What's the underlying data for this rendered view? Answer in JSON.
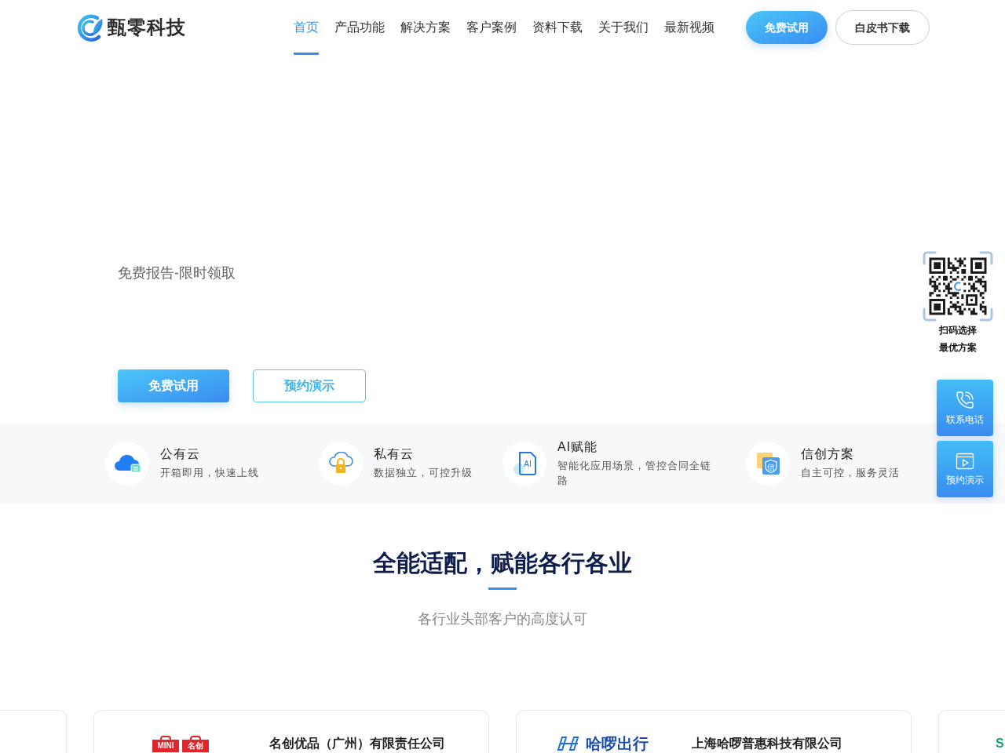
{
  "header": {
    "logo": {
      "text": "甄零科技"
    },
    "nav": [
      {
        "label": "首页",
        "selected": true
      },
      {
        "label": "产品功能",
        "selected": false
      },
      {
        "label": "解决方案",
        "selected": false
      },
      {
        "label": "客户案例",
        "selected": false
      },
      {
        "label": "资料下载",
        "selected": false
      },
      {
        "label": "关于我们",
        "selected": false
      },
      {
        "label": "最新视频",
        "selected": false
      }
    ],
    "buttons": [
      {
        "label": "免费试用",
        "kind": "primary"
      },
      {
        "label": "白皮书下载",
        "kind": "outline"
      }
    ]
  },
  "hero": {
    "tagline": "免费报告-限时领取",
    "buttons": [
      {
        "label": "免费试用",
        "kind": "primary"
      },
      {
        "label": "预约演示",
        "kind": "outline"
      }
    ]
  },
  "features": [
    {
      "kind": "cloud",
      "title": "公有云",
      "description": "开箱即用，快速上线"
    },
    {
      "kind": "lock",
      "title": "私有云",
      "description": "数据独立，可控升级"
    },
    {
      "kind": "ai",
      "icon_text": "AI",
      "title": "AI赋能",
      "description": "智能化应用场景，管控合同全链路"
    },
    {
      "kind": "shield",
      "icon_text": "信",
      "title": "信创方案",
      "description": "自主可控，服务灵活"
    }
  ],
  "section": {
    "title": "全能适配，赋能各行各业",
    "subtitle": "各行业头部客户的高度认可"
  },
  "clients": [
    {
      "kind": "blank"
    },
    {
      "kind": "bags",
      "logo_text": [
        "MINI",
        "名创"
      ],
      "name": "名创优品（广州）有限责任公司"
    },
    {
      "kind": "stripes",
      "logo_text": [
        "哈啰出行"
      ],
      "name": "上海哈啰普惠科技有限公司"
    },
    {
      "kind": "cutoff",
      "logo_text": [
        "S"
      ]
    }
  ],
  "side_panel": {
    "qr_caption": [
      "扫码选择",
      "最优方案"
    ],
    "buttons": [
      {
        "kind": "phone",
        "label": "联系电话"
      },
      {
        "kind": "video",
        "label": "预约演示"
      }
    ]
  }
}
